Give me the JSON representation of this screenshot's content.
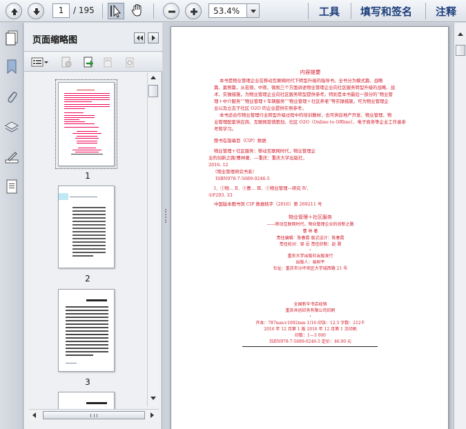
{
  "toolbar": {
    "current_page": "1",
    "total_pages": "/ 195",
    "zoom": "53.4%",
    "links": [
      "工具",
      "填写和签名",
      "注释"
    ]
  },
  "panel": {
    "title": "页面缩略图",
    "thumbnails": [
      "1",
      "2",
      "3"
    ]
  },
  "document": {
    "summary_title": "内容提要",
    "summary_paragraphs": [
      "本书是物业管理企业在移动互联网时代下转型升级的指导书。全书分为模式篇、战略",
      "篇、案例篇，从宏观、中观、微观三个方面讲述物业管理企业向社区服务转型升级的战略、战",
      "术、实操措施，为物业管理企业向社区服务转型提供参考。特别是本书最后一部分的“物业管",
      "理＋中介服务”“物业管理＋车辆服务”“物业管理＋社区养老”等实操措施，可为物业管理企",
      "业以及立志于社区 O2O 的企业提供实例参考。",
      "本书适合作物业管理行业转型升级过程中的培训教材，也可供房地产开发、物业管理、物",
      "业管理配套供应商、互联网营销策划、社区 O2O（Online to Offline）、电子商务等企业工作者参",
      "考和学习。"
    ],
    "cip_title": "图书在版编目（CIP）数据",
    "cip_lines": [
      "物业管理＋社区服务：移动互联网时代，物业管理企",
      "业的创新之路/曹林著．—重庆：重庆大学出版社，",
      "2016. 12",
      "（物业管理研究书系）",
      "ISBN978-7-5689-0246-5",
      "Ⅰ．①物…  Ⅱ．①曹…  Ⅲ．①物业管理—研究  Ⅳ．",
      "①F293. 33"
    ],
    "cip_number": "中国版本图书馆 CIP 数据核字（2016）第 269211 号",
    "book_title": "物业管理＋社区服务",
    "book_subtitle": "——移动互联网时代，物业管理企业的创新之路",
    "author": "曹  林  著",
    "editors_1": "责任编辑：陈春霞      版式设计：陈春霞",
    "editors_2": "责任校对：邹  忌      责任印制：赵  晟",
    "publisher": "重庆大学出版社出版发行",
    "publisher_person": "出版人：易树平",
    "address": "社址：重庆市沙坪坝区大学城西路 21 号",
    "distributor": "全国新华书店经销",
    "printer": "重庆共创印务有限公司印刷",
    "format_line": "开本：787mm×1092mm  1/16  印张：12.5  字数：212千",
    "edition_line": "2016 年 12 月第 1 版  2016 年 12 月第 1 次印刷",
    "print_count": "印数：1—3 000",
    "isbn_price": "ISBN978-7-5689-0246-5  定价：46.00 元"
  }
}
